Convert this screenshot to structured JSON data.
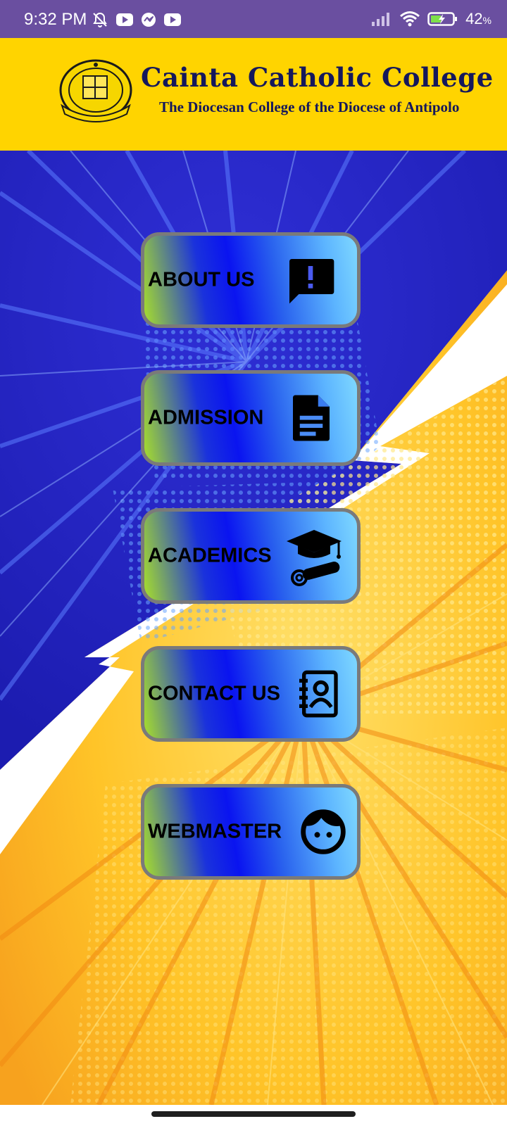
{
  "status_bar": {
    "time": "9:32 PM",
    "battery_percent": "42",
    "battery_unit": "%",
    "icons_left": [
      "bell-off-icon",
      "youtube-icon",
      "messenger-icon",
      "youtube-icon"
    ],
    "icons_right": [
      "signal-icon",
      "wifi-icon",
      "battery-charging-icon"
    ]
  },
  "header": {
    "title": "Cainta Catholic College",
    "subtitle": "The Diocesan College of the Diocese of Antipolo",
    "logo": "college-seal",
    "background": "#ffd400",
    "text_color": "#15185c"
  },
  "menu": {
    "items": [
      {
        "label": "ABOUT US",
        "icon": "feedback-alert-icon"
      },
      {
        "label": "ADMISSION",
        "icon": "document-icon"
      },
      {
        "label": "ACADEMICS",
        "icon": "graduation-icon"
      },
      {
        "label": "CONTACT US",
        "icon": "contacts-book-icon"
      },
      {
        "label": "WEBMASTER",
        "icon": "face-icon"
      }
    ],
    "border_color": "#7a7a7a"
  },
  "colors": {
    "status_bar": "#6a4fa0",
    "bg_blue": "#2a2bc8",
    "bg_yellow": "#ffc928"
  }
}
